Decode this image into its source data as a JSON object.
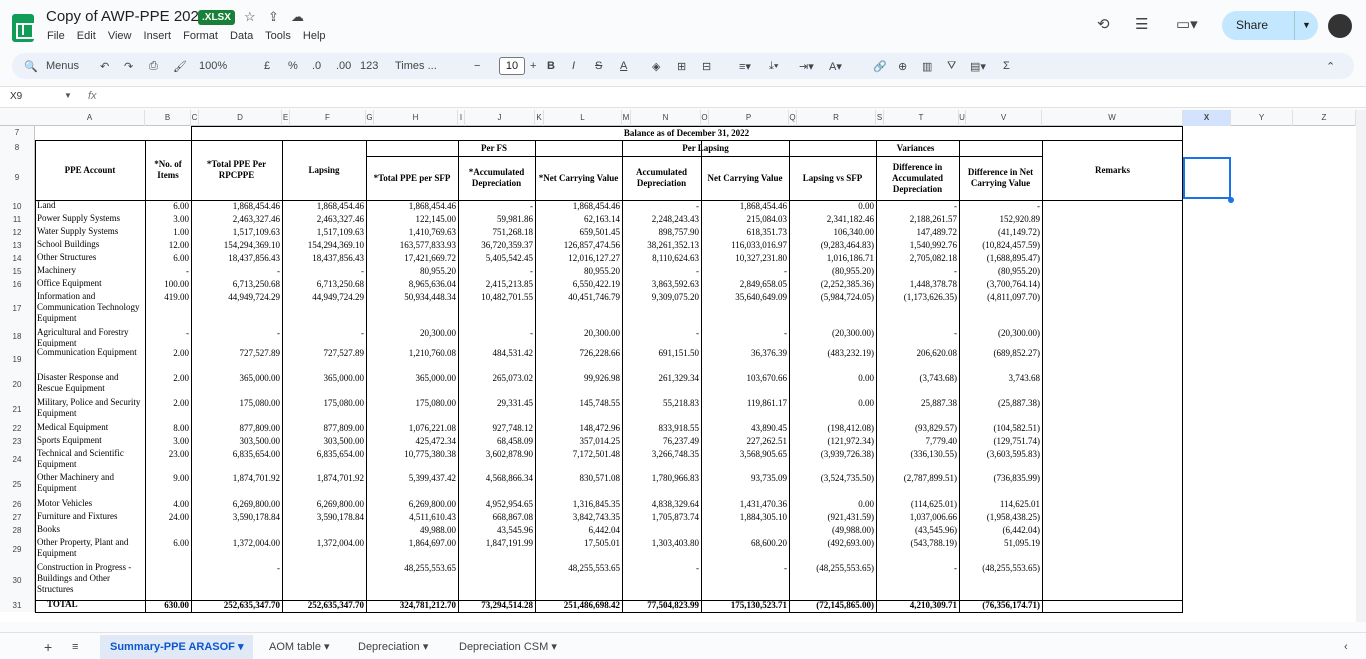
{
  "app": {
    "title": "Copy of AWP-PPE 2022",
    "badge": ".XLSX",
    "menus": [
      "File",
      "Edit",
      "View",
      "Insert",
      "Format",
      "Data",
      "Tools",
      "Help"
    ],
    "share": "Share"
  },
  "toolbar": {
    "menus": "Menus",
    "zoom": "100%",
    "currency": "£",
    "percent": "%",
    "dec_less": ".0",
    "dec_more": ".00",
    "fmt": "123",
    "font": "Times ...",
    "font_size": "10",
    "bold": "B",
    "italic": "I"
  },
  "formula": {
    "cell": "X9",
    "fx": "fx"
  },
  "columns": [
    "A",
    "B",
    "C",
    "D",
    "E",
    "F",
    "G",
    "H",
    "I",
    "J",
    "K",
    "L",
    "M",
    "N",
    "O",
    "P",
    "Q",
    "R",
    "S",
    "T",
    "U",
    "V",
    "W",
    "X",
    "Y",
    "Z"
  ],
  "headers": {
    "balance": "Balance as of December 31, 2022",
    "per_fs": "Per FS",
    "per_lapsing": "Per Lapsing",
    "variances": "Variances",
    "ppe_account": "PPE Account",
    "no_items": "*No. of Items",
    "total_ppe_rpcppe": "*Total PPE Per RPCPPE",
    "lapsing": "Lapsing",
    "total_ppe_sfp": "*Total PPE per SFP",
    "acc_dep": "*Accumulated Depreciation",
    "net_cv": "*Net Carrying Value",
    "acc_dep2": "Accumulated Depreciation",
    "net_cv2": "Net Carrying Value",
    "lap_vs_sfp": "Lapsing vs SFP",
    "diff_acc": "Difference in Accumulated Depreciation",
    "diff_net": "Difference in Net Carrying Value",
    "remarks": "Remarks"
  },
  "rows": [
    {
      "n": "10",
      "acct": "Land",
      "items": "6.00",
      "d": "1,868,454.46",
      "f": "1,868,454.46",
      "h": "1,868,454.46",
      "j": "-",
      "l": "1,868,454.46",
      "nn": "-",
      "p": "1,868,454.46",
      "r": "0.00",
      "t": "-",
      "v": "-"
    },
    {
      "n": "11",
      "acct": "Power Supply Systems",
      "items": "3.00",
      "d": "2,463,327.46",
      "f": "2,463,327.46",
      "h": "122,145.00",
      "j": "59,981.86",
      "l": "62,163.14",
      "nn": "2,248,243.43",
      "p": "215,084.03",
      "r": "2,341,182.46",
      "t": "2,188,261.57",
      "v": "152,920.89"
    },
    {
      "n": "12",
      "acct": "Water Supply Systems",
      "items": "1.00",
      "d": "1,517,109.63",
      "f": "1,517,109.63",
      "h": "1,410,769.63",
      "j": "751,268.18",
      "l": "659,501.45",
      "nn": "898,757.90",
      "p": "618,351.73",
      "r": "106,340.00",
      "t": "147,489.72",
      "v": "(41,149.72)"
    },
    {
      "n": "13",
      "acct": "School Buildings",
      "items": "12.00",
      "d": "154,294,369.10",
      "f": "154,294,369.10",
      "h": "163,577,833.93",
      "j": "36,720,359.37",
      "l": "126,857,474.56",
      "nn": "38,261,352.13",
      "p": "116,033,016.97",
      "r": "(9,283,464.83)",
      "t": "1,540,992.76",
      "v": "(10,824,457.59)"
    },
    {
      "n": "14",
      "acct": "Other Structures",
      "items": "6.00",
      "d": "18,437,856.43",
      "f": "18,437,856.43",
      "h": "17,421,669.72",
      "j": "5,405,542.45",
      "l": "12,016,127.27",
      "nn": "8,110,624.63",
      "p": "10,327,231.80",
      "r": "1,016,186.71",
      "t": "2,705,082.18",
      "v": "(1,688,895.47)"
    },
    {
      "n": "15",
      "acct": "Machinery",
      "items": "-",
      "d": "-",
      "f": "-",
      "h": "80,955.20",
      "j": "-",
      "l": "80,955.20",
      "nn": "-",
      "p": "-",
      "r": "(80,955.20)",
      "t": "-",
      "v": "(80,955.20)"
    },
    {
      "n": "16",
      "acct": "Office Equipment",
      "items": "100.00",
      "d": "6,713,250.68",
      "f": "6,713,250.68",
      "h": "8,965,636.04",
      "j": "2,415,213.85",
      "l": "6,550,422.19",
      "nn": "3,863,592.63",
      "p": "2,849,658.05",
      "r": "(2,252,385.36)",
      "t": "1,448,378.78",
      "v": "(3,700,764.14)"
    },
    {
      "n": "17",
      "acct": "Information and Communication Technology Equipment",
      "items": "419.00",
      "d": "44,949,724.29",
      "f": "44,949,724.29",
      "h": "50,934,448.34",
      "j": "10,482,701.55",
      "l": "40,451,746.79",
      "nn": "9,309,075.20",
      "p": "35,640,649.09",
      "r": "(5,984,724.05)",
      "t": "(1,173,626.35)",
      "v": "(4,811,097.70)"
    },
    {
      "n": "18",
      "acct": "Agricultural and Forestry Equipment",
      "items": "-",
      "d": "-",
      "f": "-",
      "h": "20,300.00",
      "j": "-",
      "l": "20,300.00",
      "nn": "-",
      "p": "-",
      "r": "(20,300.00)",
      "t": "-",
      "v": "(20,300.00)"
    },
    {
      "n": "19",
      "acct": "Communication Equipment",
      "items": "2.00",
      "d": "727,527.89",
      "f": "727,527.89",
      "h": "1,210,760.08",
      "j": "484,531.42",
      "l": "726,228.66",
      "nn": "691,151.50",
      "p": "36,376.39",
      "r": "(483,232.19)",
      "t": "206,620.08",
      "v": "(689,852.27)"
    },
    {
      "n": "20",
      "acct": "Disaster Response and Rescue Equipment",
      "items": "2.00",
      "d": "365,000.00",
      "f": "365,000.00",
      "h": "365,000.00",
      "j": "265,073.02",
      "l": "99,926.98",
      "nn": "261,329.34",
      "p": "103,670.66",
      "r": "0.00",
      "t": "(3,743.68)",
      "v": "3,743.68"
    },
    {
      "n": "21",
      "acct": "Military, Police and Security Equipment",
      "items": "2.00",
      "d": "175,080.00",
      "f": "175,080.00",
      "h": "175,080.00",
      "j": "29,331.45",
      "l": "145,748.55",
      "nn": "55,218.83",
      "p": "119,861.17",
      "r": "0.00",
      "t": "25,887.38",
      "v": "(25,887.38)"
    },
    {
      "n": "22",
      "acct": "Medical Equipment",
      "items": "8.00",
      "d": "877,809.00",
      "f": "877,809.00",
      "h": "1,076,221.08",
      "j": "927,748.12",
      "l": "148,472.96",
      "nn": "833,918.55",
      "p": "43,890.45",
      "r": "(198,412.08)",
      "t": "(93,829.57)",
      "v": "(104,582.51)"
    },
    {
      "n": "23",
      "acct": "Sports Equipment",
      "items": "3.00",
      "d": "303,500.00",
      "f": "303,500.00",
      "h": "425,472.34",
      "j": "68,458.09",
      "l": "357,014.25",
      "nn": "76,237.49",
      "p": "227,262.51",
      "r": "(121,972.34)",
      "t": "7,779.40",
      "v": "(129,751.74)"
    },
    {
      "n": "24",
      "acct": "Technical and Scientific Equipment",
      "items": "23.00",
      "d": "6,835,654.00",
      "f": "6,835,654.00",
      "h": "10,775,380.38",
      "j": "3,602,878.90",
      "l": "7,172,501.48",
      "nn": "3,266,748.35",
      "p": "3,568,905.65",
      "r": "(3,939,726.38)",
      "t": "(336,130.55)",
      "v": "(3,603,595.83)"
    },
    {
      "n": "25",
      "acct": "Other Machinery and Equipment",
      "items": "9.00",
      "d": "1,874,701.92",
      "f": "1,874,701.92",
      "h": "5,399,437.42",
      "j": "4,568,866.34",
      "l": "830,571.08",
      "nn": "1,780,966.83",
      "p": "93,735.09",
      "r": "(3,524,735.50)",
      "t": "(2,787,899.51)",
      "v": "(736,835.99)"
    },
    {
      "n": "26",
      "acct": "Motor Vehicles",
      "items": "4.00",
      "d": "6,269,800.00",
      "f": "6,269,800.00",
      "h": "6,269,800.00",
      "j": "4,952,954.65",
      "l": "1,316,845.35",
      "nn": "4,838,329.64",
      "p": "1,431,470.36",
      "r": "0.00",
      "t": "(114,625.01)",
      "v": "114,625.01"
    },
    {
      "n": "27",
      "acct": "Furniture and Fixtures",
      "items": "24.00",
      "d": "3,590,178.84",
      "f": "3,590,178.84",
      "h": "4,511,610.43",
      "j": "668,867.08",
      "l": "3,842,743.35",
      "nn": "1,705,873.74",
      "p": "1,884,305.10",
      "r": "(921,431.59)",
      "t": "1,037,006.66",
      "v": "(1,958,438.25)"
    },
    {
      "n": "28",
      "acct": "Books",
      "items": "",
      "d": "",
      "f": "",
      "h": "49,988.00",
      "j": "43,545.96",
      "l": "6,442.04",
      "nn": "",
      "p": "",
      "r": "(49,988.00)",
      "t": "(43,545.96)",
      "v": "(6,442.04)"
    },
    {
      "n": "29",
      "acct": "Other Property, Plant and Equipment",
      "items": "6.00",
      "d": "1,372,004.00",
      "f": "1,372,004.00",
      "h": "1,864,697.00",
      "j": "1,847,191.99",
      "l": "17,505.01",
      "nn": "1,303,403.80",
      "p": "68,600.20",
      "r": "(492,693.00)",
      "t": "(543,788.19)",
      "v": "51,095.19"
    },
    {
      "n": "30",
      "acct": "Construction in Progress - Buildings and Other Structures",
      "items": "",
      "d": "-",
      "f": "",
      "h": "48,255,553.65",
      "j": "",
      "l": "48,255,553.65",
      "nn": "-",
      "p": "-",
      "r": "(48,255,553.65)",
      "t": "-",
      "v": "(48,255,553.65)"
    },
    {
      "n": "31",
      "acct": "TOTAL",
      "items": "630.00",
      "d": "252,635,347.70",
      "f": "252,635,347.70",
      "h": "324,781,212.70",
      "j": "73,294,514.28",
      "l": "251,486,698.42",
      "nn": "77,504,823.99",
      "p": "175,130,523.71",
      "r": "(72,145,865.00)",
      "t": "4,210,309.71",
      "v": "(76,356,174.71)"
    }
  ],
  "tabs": [
    "Summary-PPE ARASOF",
    "AOM table",
    "Depreciation",
    "Depreciation CSM"
  ]
}
